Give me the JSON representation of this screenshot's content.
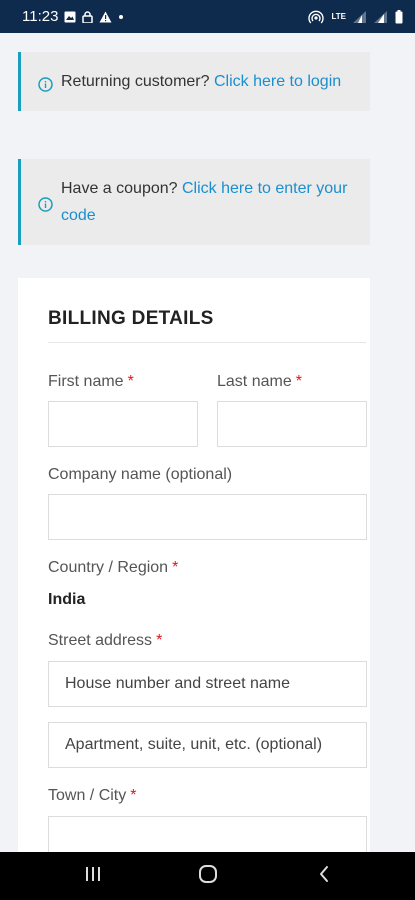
{
  "status_bar": {
    "time": "11:23",
    "left_icons": [
      "gallery-icon",
      "lock-icon",
      "warning-icon",
      "dot-icon"
    ],
    "right_icons": [
      "hotspot-icon",
      "lte-icon",
      "signal-icon",
      "signal-icon",
      "battery-icon"
    ],
    "lte_text": "LTE"
  },
  "notices": {
    "returning": {
      "text": "Returning customer? ",
      "link": "Click here to login"
    },
    "coupon": {
      "text": "Have a coupon? ",
      "link": "Click here to enter your code"
    }
  },
  "billing": {
    "title": "BILLING DETAILS",
    "required_mark": "*",
    "first_name": {
      "label": "First name",
      "value": ""
    },
    "last_name": {
      "label": "Last name",
      "value": ""
    },
    "company": {
      "label": "Company name (optional)",
      "value": ""
    },
    "country": {
      "label": "Country / Region",
      "value": "India"
    },
    "street": {
      "label": "Street address",
      "placeholder_1": "House number and street name",
      "placeholder_2": "Apartment, suite, unit, etc. (optional)"
    },
    "city": {
      "label": "Town / City",
      "value": ""
    }
  },
  "colors": {
    "accent": "#1a9ebd",
    "link": "#1a8fcf",
    "required": "#e0161e",
    "status_bar": "#0e2a4d"
  }
}
